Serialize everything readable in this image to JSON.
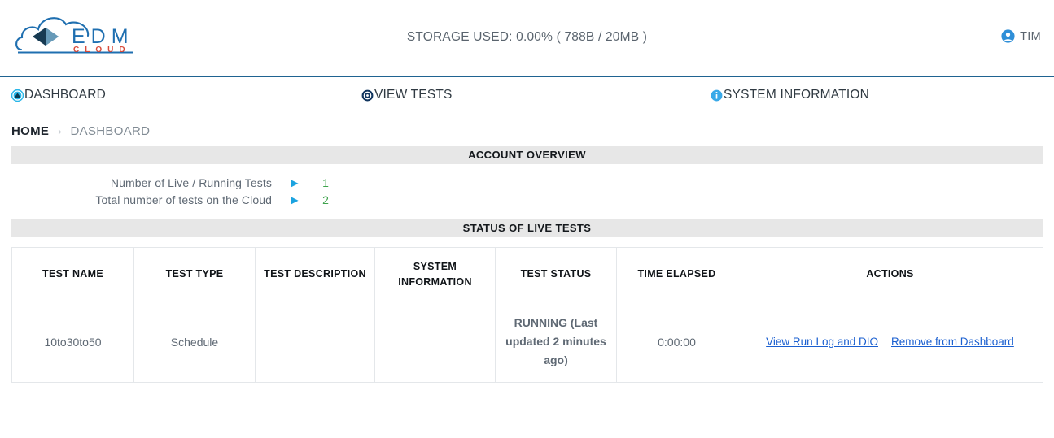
{
  "header": {
    "logo": {
      "icon": "edm-cloud-logo",
      "primary_text": "E D M",
      "secondary_text": "C L O U D",
      "primary_color": "#1f6fb0",
      "secondary_color": "#d94b3a"
    },
    "storage_used": "STORAGE USED: 0.00% ( 788B / 20MB )",
    "user": {
      "icon": "user-account-icon",
      "name": "TIM"
    },
    "border_color": "#1f6391"
  },
  "nav": {
    "items": [
      {
        "id": "dashboard",
        "label": "DASHBOARD",
        "icon": "dashboard-icon",
        "icon_color": "#29b6e8"
      },
      {
        "id": "view-tests",
        "label": "VIEW TESTS",
        "icon": "view-tests-target-icon",
        "icon_color": "#12365f"
      },
      {
        "id": "system-information",
        "label": "SYSTEM INFORMATION",
        "icon": "info-circle-icon",
        "icon_color": "#39a9e8"
      }
    ]
  },
  "breadcrumb": {
    "home": "HOME",
    "separator": "›",
    "current": "DASHBOARD"
  },
  "account_overview": {
    "title": "ACCOUNT OVERVIEW",
    "arrow_glyph": "▶",
    "rows": [
      {
        "label": "Number of Live / Running Tests",
        "value": "1"
      },
      {
        "label": "Total number of tests on the Cloud",
        "value": "2"
      }
    ]
  },
  "live_tests": {
    "title": "STATUS OF LIVE TESTS",
    "columns": [
      "TEST NAME",
      "TEST TYPE",
      "TEST DESCRIPTION",
      "SYSTEM INFORMATION",
      "TEST STATUS",
      "TIME ELAPSED",
      "ACTIONS"
    ],
    "rows": [
      {
        "test_name": "10to30to50",
        "test_type": "Schedule",
        "test_description": "",
        "system_information": "",
        "test_status": "RUNNING\n(Last updated 2 minutes ago)",
        "time_elapsed": "0:00:00",
        "actions": [
          {
            "label": "View Run Log and DIO"
          },
          {
            "label": "Remove from Dashboard"
          }
        ]
      }
    ]
  },
  "colors": {
    "accent_blue": "#1f6391",
    "status_green": "#1f8a36",
    "value_green": "#3fa34d",
    "link_blue": "#1a5fd0",
    "panel_gray": "#e7e7e7"
  }
}
